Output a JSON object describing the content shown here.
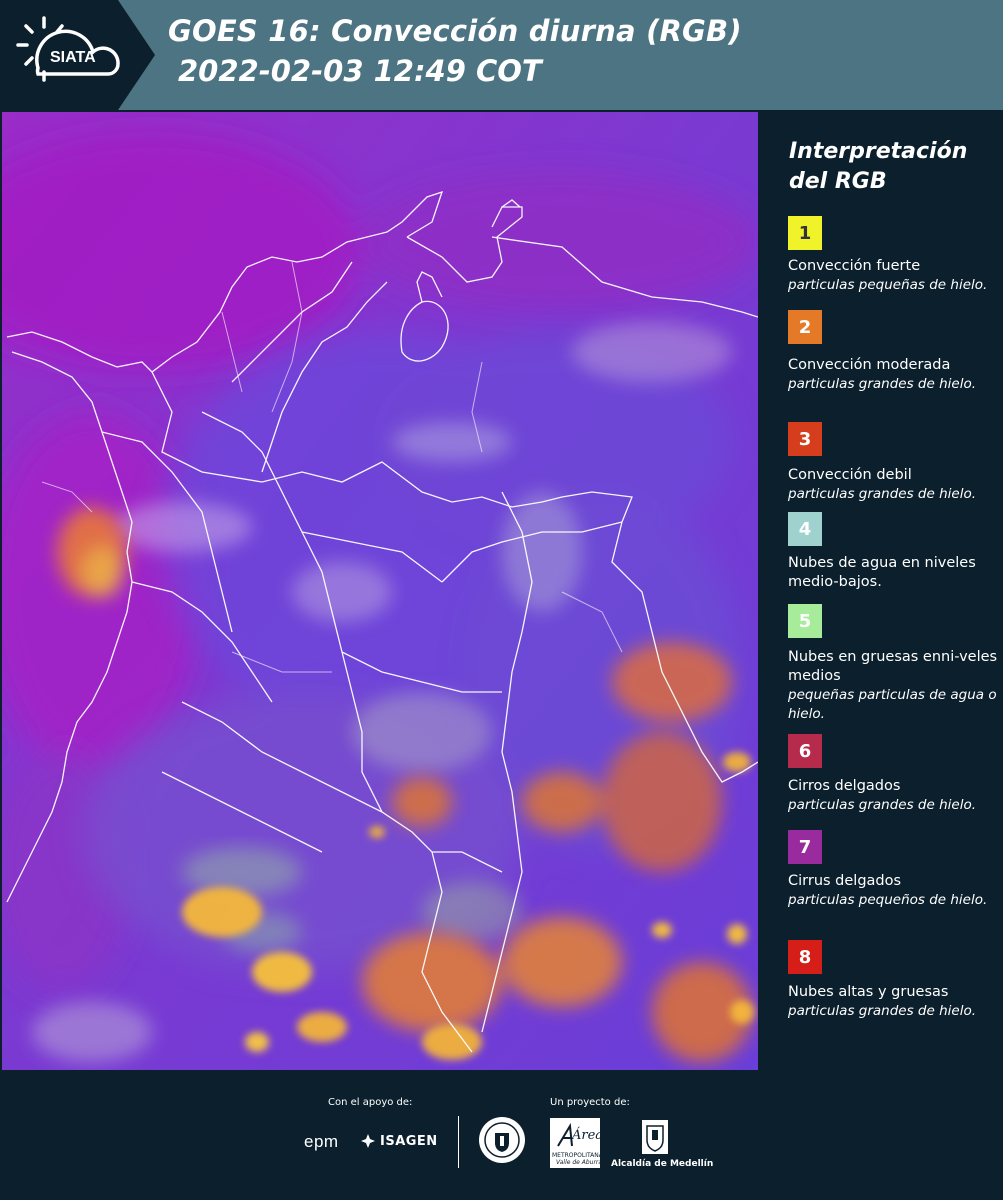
{
  "header": {
    "logo_text": "SIATA",
    "title_line1": "GOES 16: Convección diurna (RGB)",
    "title_line2": "2022-02-03 12:49 COT"
  },
  "legend": {
    "title_line1": "Interpretación",
    "title_line2": "del RGB",
    "items": [
      {
        "number": "1",
        "color": "#f0f22a",
        "text_color": "#333333",
        "label": "Convección fuerte",
        "sub": "particulas pequeñas de hielo."
      },
      {
        "number": "2",
        "color": "#e47a27",
        "text_color": "#ffffff",
        "label": "Convección moderada",
        "sub": "particulas grandes de hielo."
      },
      {
        "number": "3",
        "color": "#d53d1c",
        "text_color": "#ffffff",
        "label": "Convección debil",
        "sub": "particulas grandes de hielo."
      },
      {
        "number": "4",
        "color": "#9fd2ce",
        "text_color": "#ffffff",
        "label": "Nubes de agua en niveles medio-bajos.",
        "sub": ""
      },
      {
        "number": "5",
        "color": "#a7ec9b",
        "text_color": "#ffffff",
        "label": "Nubes en gruesas enni-veles medios",
        "sub": "pequeñas particulas de agua o hielo."
      },
      {
        "number": "6",
        "color": "#b62a4b",
        "text_color": "#ffffff",
        "label": "Cirros delgados",
        "sub": "particulas grandes de hielo."
      },
      {
        "number": "7",
        "color": "#992b9f",
        "text_color": "#ffffff",
        "label": "Cirrus delgados",
        "sub": "particulas pequeños de hielo."
      },
      {
        "number": "8",
        "color": "#d61e18",
        "text_color": "#ffffff",
        "label": "Nubes altas y gruesas",
        "sub": "particulas grandes de hielo."
      }
    ]
  },
  "footer": {
    "support_label": "Con el apoyo de:",
    "project_label": "Un proyecto de:",
    "sponsor_epm": "epm",
    "sponsor_isagen": "ISAGEN",
    "area_logo_text": "Área",
    "area_sub1": "METROPOLITANA",
    "area_sub2": "Valle de Aburrá",
    "alcaldia": "Alcaldía de Medellín"
  }
}
